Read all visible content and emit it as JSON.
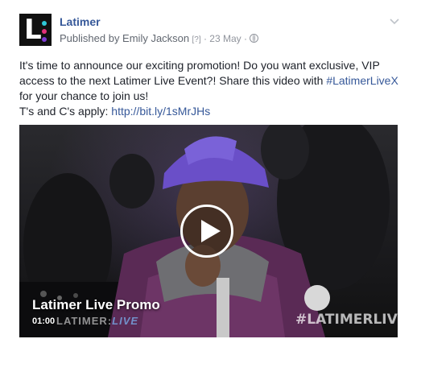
{
  "page": {
    "name": "Latimer"
  },
  "meta": {
    "published_by": "Published by Emily Jackson",
    "help": "[?]",
    "separator1": "·",
    "date": "23 May",
    "separator2": "·",
    "audience_icon": "globe-icon"
  },
  "avatar": {
    "letter": "L:",
    "colors": [
      "#2ec7d8",
      "#e2317a",
      "#7d3ad6"
    ]
  },
  "post": {
    "line1": "It's time to announce our exciting promotion! Do you want exclusive, VIP access to the next Latimer Live Event?! Share this video with ",
    "hashtag": "#LatimerLiveX",
    "line2": " for your chance to join us!",
    "terms_label": "T's and C's apply: ",
    "link": "http://bit.ly/1sMrJHs"
  },
  "video": {
    "title": "Latimer Live Promo",
    "duration": "01:00",
    "brand": "LATIMER",
    "brand_live": "LIVE",
    "overlay_hashtag": "#LATIMERLIVEX",
    "play_icon": "play-icon"
  },
  "colors": {
    "link": "#365899",
    "meta": "#90949c"
  }
}
